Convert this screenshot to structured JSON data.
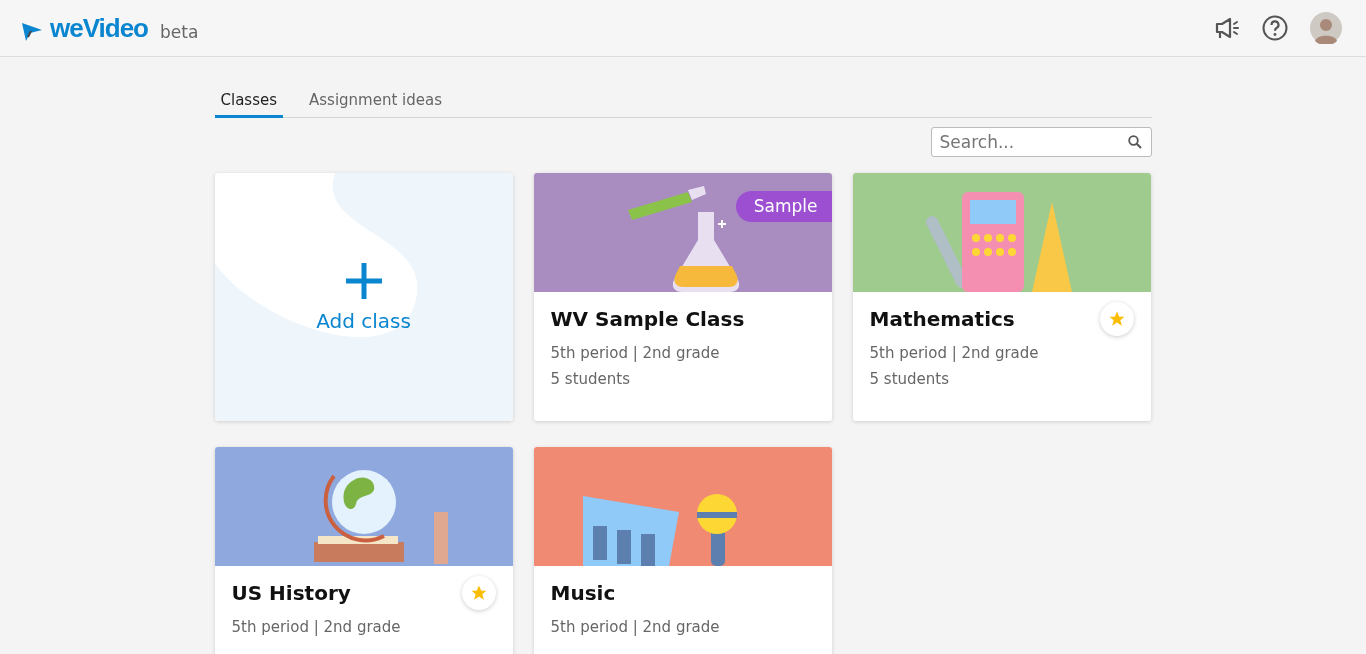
{
  "header": {
    "logo": "weVideo",
    "logo_suffix": "beta"
  },
  "tabs": [
    {
      "label": "Classes",
      "selected": true
    },
    {
      "label": "Assignment ideas",
      "selected": false
    }
  ],
  "search": {
    "placeholder": "Search..."
  },
  "cards": [
    {
      "kind": "add",
      "label": "Add class"
    },
    {
      "kind": "class",
      "title": "WV Sample Class",
      "details": "5th period | 2nd grade",
      "students": "5 students",
      "starred": false,
      "badge": "Sample"
    },
    {
      "kind": "class",
      "title": "Mathematics",
      "details": "5th period | 2nd grade",
      "students": "5 students",
      "starred": true
    },
    {
      "kind": "class",
      "title": "US History",
      "details": "5th period | 2nd grade",
      "starred": true
    },
    {
      "kind": "class",
      "title": "Music",
      "details": "5th period | 2nd grade",
      "starred": false
    }
  ]
}
